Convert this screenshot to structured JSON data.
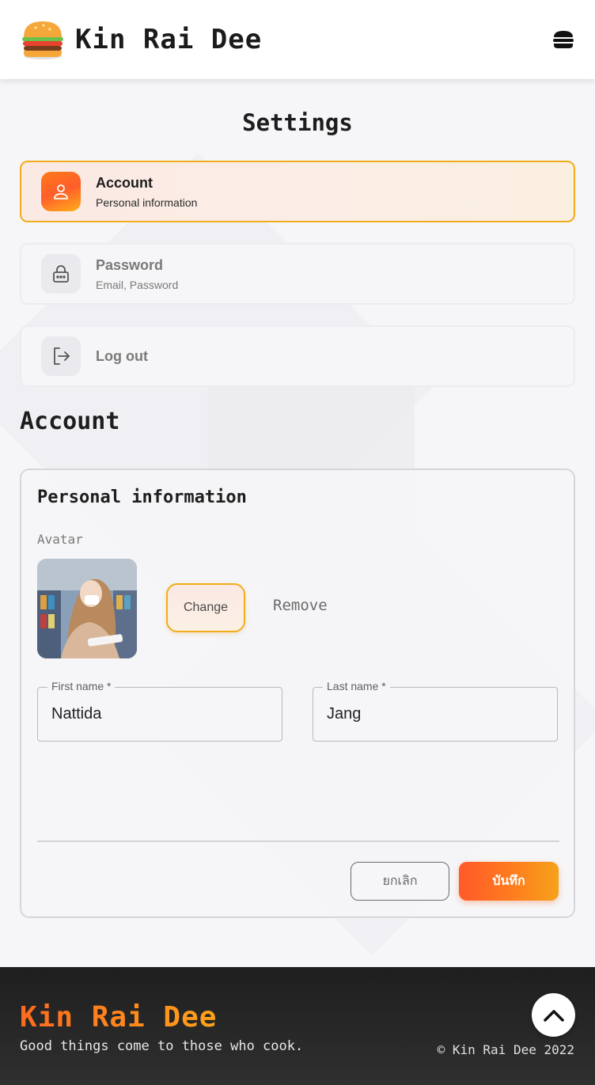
{
  "header": {
    "brand": "Kin Rai Dee",
    "logo_icon": "burger-icon",
    "menu_icon": "burger-menu-icon"
  },
  "settings": {
    "title": "Settings",
    "items": [
      {
        "label": "Account",
        "sublabel": "Personal information",
        "icon": "user-icon",
        "active": true
      },
      {
        "label": "Password",
        "sublabel": "Email, Password",
        "icon": "lock-icon",
        "active": false
      },
      {
        "label": "Log out",
        "sublabel": "",
        "icon": "logout-icon",
        "active": false
      }
    ]
  },
  "account": {
    "title": "Account",
    "panel_title": "Personal information",
    "avatar_label": "Avatar",
    "change_label": "Change",
    "remove_label": "Remove",
    "first_name_label": "First name",
    "first_name_value": "Nattida",
    "last_name_label": "Last name",
    "last_name_value": "Jang",
    "required_mark": "*",
    "cancel_label": "ยกเลิก",
    "save_label": "บันทึก"
  },
  "footer": {
    "brand": "Kin Rai Dee",
    "tagline": "Good things come to those who cook.",
    "copyright": "© Kin Rai Dee 2022",
    "top_icon": "chevron-up-icon"
  },
  "colors": {
    "accent_orange": "#ff6a1f",
    "accent_yellow": "#f0ad1c",
    "footer_bg": "#262626"
  }
}
